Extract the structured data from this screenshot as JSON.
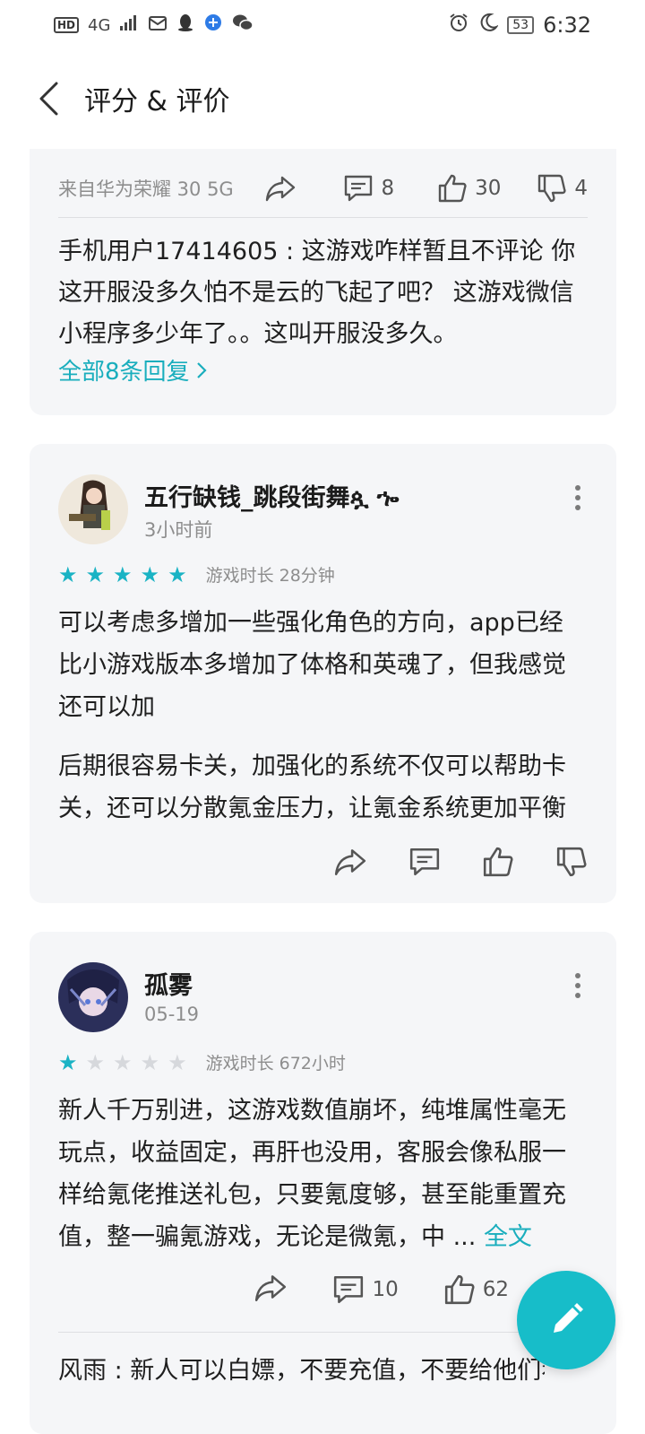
{
  "status_bar": {
    "left_icons": [
      "hd-icon",
      "signal-4g-icon",
      "signal-bars-icon",
      "mail-app-icon",
      "qq-icon",
      "browser-icon",
      "wechat-icon"
    ],
    "hd_label": "HD",
    "net_label": "4G",
    "battery": "53",
    "time": "6:32"
  },
  "header": {
    "title": "评分 & 评价"
  },
  "reply_card": {
    "device": "来自华为荣耀 30 5G",
    "comment_count": "8",
    "like_count": "30",
    "dislike_count": "4",
    "reply_author": "手机用户17414605",
    "reply_text": "手机用户17414605 : 这游戏咋样暂且不评论 你这开服没多久怕不是云的飞起了吧？ 这游戏微信小程序多少年了。。这叫开服没多久。",
    "all_replies_label": "全部8条回复"
  },
  "reviews": [
    {
      "username": "五行缺钱_跳段街舞ጷ ኈ",
      "time": "3小时前",
      "rating": 5,
      "playtime": "游戏时长 28分钟",
      "paragraphs": [
        "可以考虑多增加一些强化角色的方向，app已经比小游戏版本多增加了体格和英魂了，但我感觉还可以加",
        "后期很容易卡关，加强化的系统不仅可以帮助卡关，还可以分散氪金压力，让氪金系统更加平衡"
      ]
    },
    {
      "username": "孤雾",
      "time": "05-19",
      "rating": 1,
      "playtime": "游戏时长 672小时",
      "text": "新人千万别进，这游戏数值崩坏，纯堆属性毫无玩点，收益固定，再肝也没用，客服会像私服一样给氪佬推送礼包，只要氪度够，甚至能重置充值，整一骗氪游戏，无论是微氪，中 ...",
      "full_text_label": "全文",
      "comment_count": "10",
      "like_count": "62",
      "reply_preview": "风雨 : 新人可以白嫖，不要充值，不要给他们看"
    }
  ],
  "colors": {
    "accent": "#1ab3c4",
    "card_bg": "#f5f6f8",
    "fab": "#17bdc9"
  }
}
